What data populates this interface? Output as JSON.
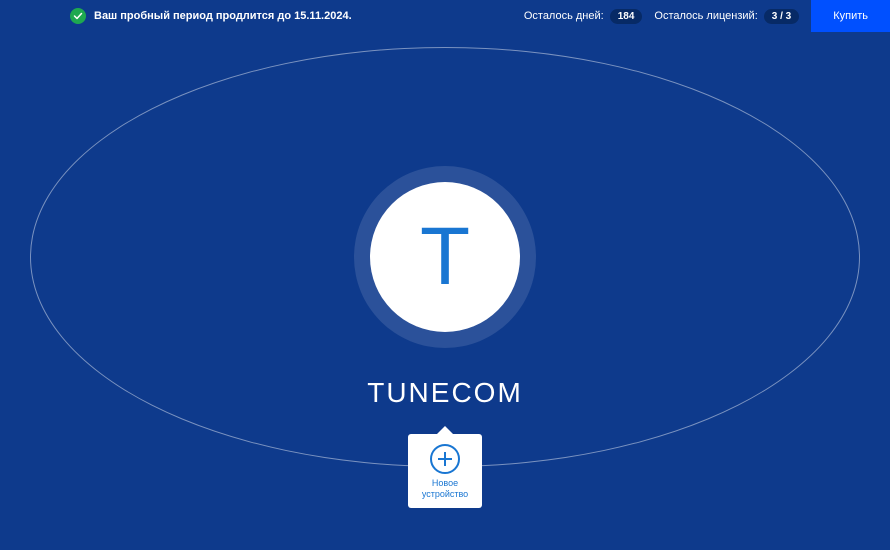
{
  "topbar": {
    "trial_message": "Ваш пробный период продлится до 15.11.2024.",
    "days_label": "Осталось дней:",
    "days_value": "184",
    "licenses_label": "Осталось лицензий:",
    "licenses_value": "3 / 3",
    "buy_label": "Купить"
  },
  "center": {
    "letter": "T",
    "name": "TUNECOM"
  },
  "add_device": {
    "line1": "Новое",
    "line2": "устройство"
  }
}
